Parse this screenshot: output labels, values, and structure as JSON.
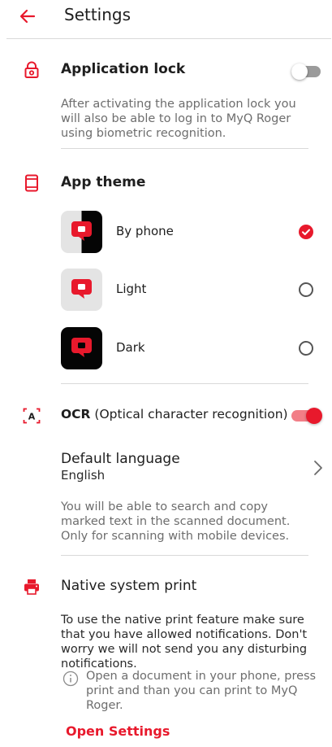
{
  "header": {
    "title": "Settings"
  },
  "app_lock": {
    "title": "Application lock",
    "enabled": false,
    "description": "After activating the application lock you will also be able to log in to MyQ Roger using biometric recognition."
  },
  "theme": {
    "title": "App theme",
    "options": [
      {
        "label": "By phone",
        "selected": true
      },
      {
        "label": "Light",
        "selected": false
      },
      {
        "label": "Dark",
        "selected": false
      }
    ]
  },
  "ocr": {
    "title_bold": "OCR",
    "title_rest": " (Optical character recognition)",
    "icon_text": "A",
    "enabled": true,
    "language_title": "Default language",
    "language_value": "English",
    "description": "You will be able to search and copy marked text in the scanned document. Only for scanning with mobile devices."
  },
  "native_print": {
    "title": "Native system print",
    "description": "To use the native print feature make sure that you have allowed notifications. Don't worry we will not send you any disturbing notifications.",
    "info": "Open a document in your phone, press print and than you can print to MyQ Roger.",
    "link": "Open Settings"
  },
  "colors": {
    "accent": "#e8192c",
    "text": "#1e1e1e",
    "muted": "#6d6d6d",
    "divider": "#d9d9d9"
  },
  "icons": [
    "back-arrow-icon",
    "lock-icon",
    "phone-icon",
    "check-icon",
    "scan-text-icon",
    "chevron-right-icon",
    "printer-icon",
    "info-icon"
  ]
}
